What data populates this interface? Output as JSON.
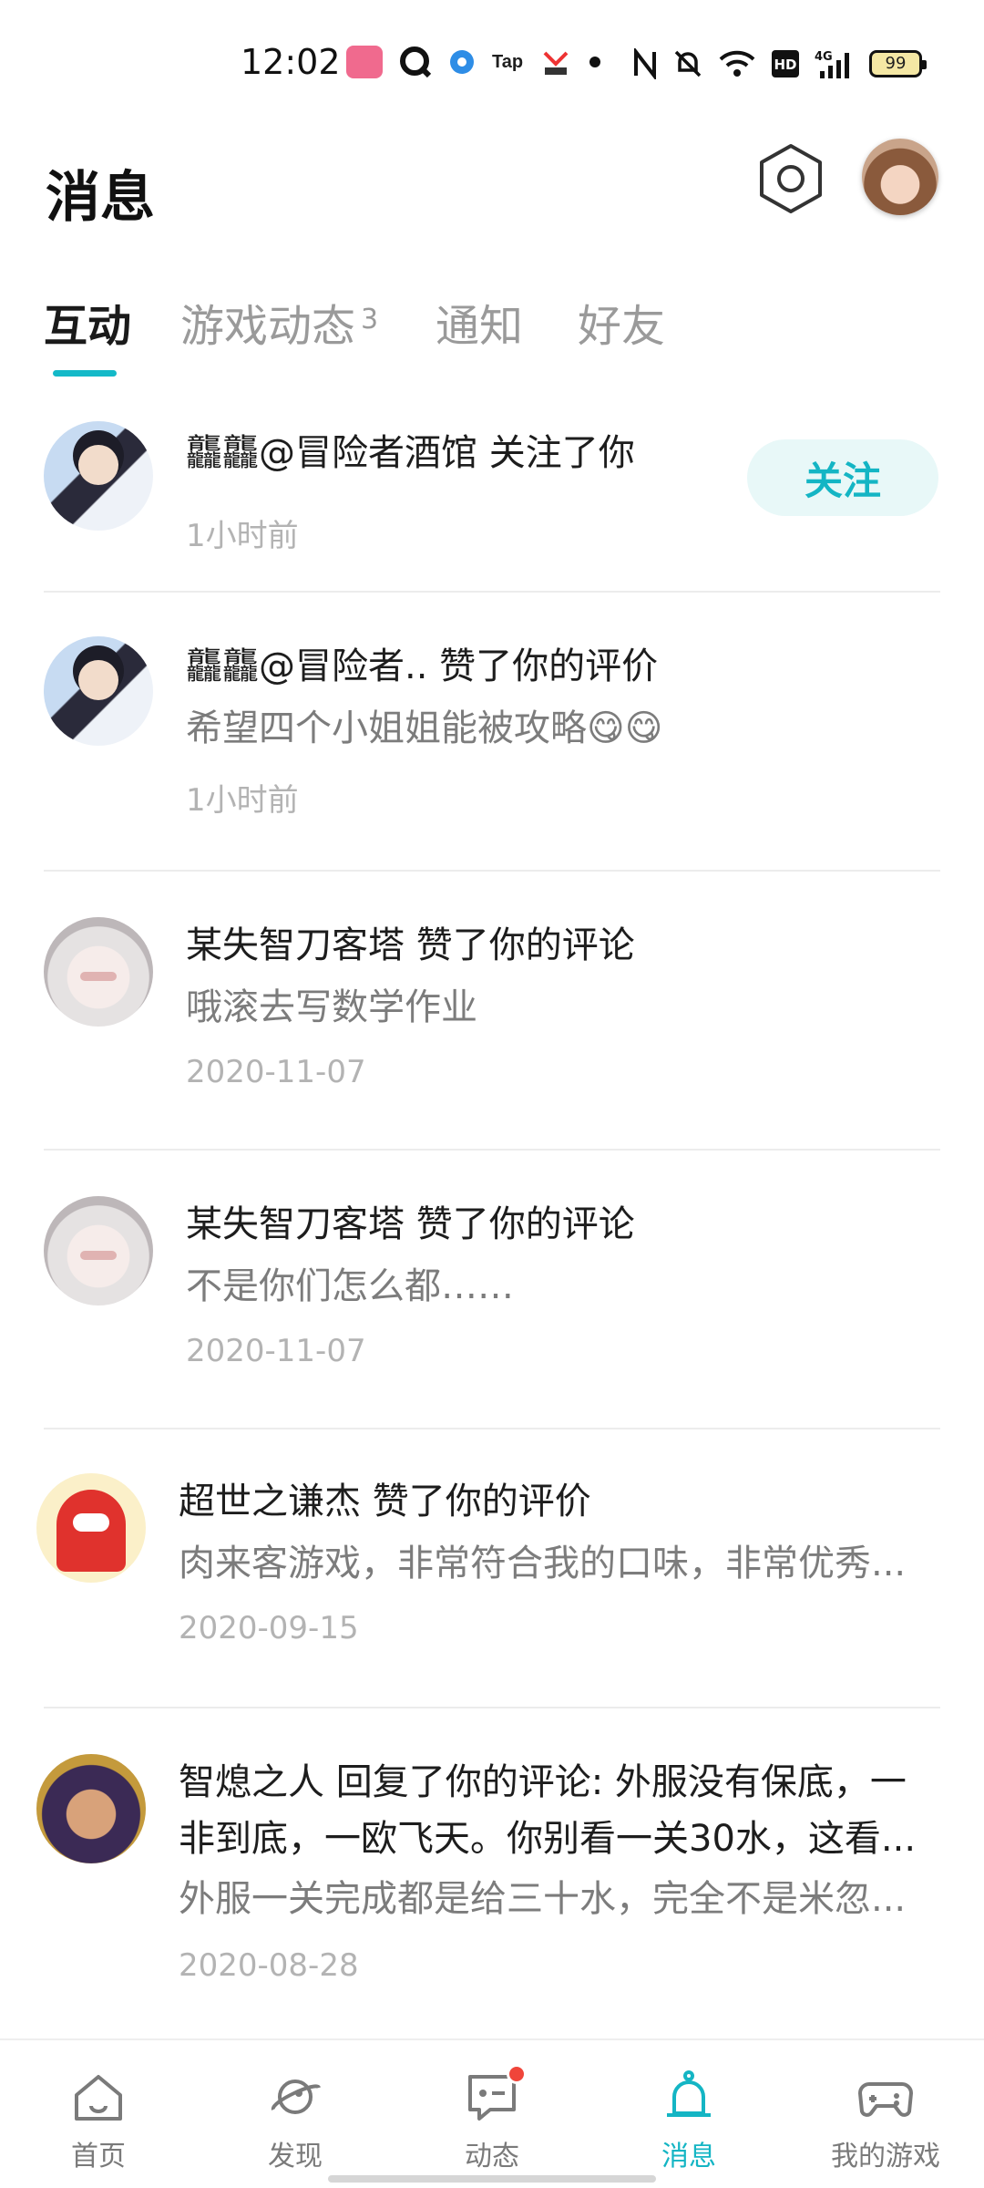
{
  "status_bar": {
    "time": "12:02",
    "battery": "99",
    "icons": [
      "bilibili-icon",
      "q-icon",
      "dot-app-icon",
      "tap-icon",
      "bird-app-icon",
      "dot-icon",
      "nfc-icon",
      "mute-icon",
      "wifi-icon",
      "hd-icon",
      "signal-4g-icon",
      "battery-icon"
    ]
  },
  "header": {
    "title": "消息"
  },
  "tabs": [
    {
      "label": "互动",
      "active": true
    },
    {
      "label": "游戏动态",
      "badge": "3"
    },
    {
      "label": "通知"
    },
    {
      "label": "好友"
    }
  ],
  "messages": [
    {
      "avatar": "maid-girl-avatar",
      "title": "龘龘@冒险者酒馆 关注了你",
      "time": "1小时前",
      "action": "关注"
    },
    {
      "avatar": "maid-girl-avatar",
      "title": "龘龘@冒险者.. 赞了你的评价",
      "content": "希望四个小姐姐能被攻略😋😋",
      "time": "1小时前"
    },
    {
      "avatar": "white-fox-girl-avatar",
      "title": "某失智刀客塔 赞了你的评论",
      "content": "哦滚去写数学作业",
      "time": "2020-11-07"
    },
    {
      "avatar": "white-fox-girl-avatar",
      "title": "某失智刀客塔 赞了你的评论",
      "content": "不是你们怎么都……",
      "time": "2020-11-07"
    },
    {
      "avatar": "red-mascot-avatar",
      "title": "超世之谦杰 赞了你的评价",
      "content": "肉来客游戏，非常符合我的口味，非常优秀...",
      "time": "2020-09-15"
    },
    {
      "avatar": "warrior-avatar",
      "title": "智熄之人 回复了你的评论: 外服没有保底，一",
      "title_line2": "非到底，一欧飞天。你别看一关30水，这看...",
      "content": "外服一关完成都是给三十水，完全不是米忽...",
      "time": "2020-08-28"
    }
  ],
  "bottom_nav": [
    {
      "label": "首页",
      "icon": "home-icon"
    },
    {
      "label": "发现",
      "icon": "planet-icon"
    },
    {
      "label": "动态",
      "icon": "chat-icon",
      "has_dot": true
    },
    {
      "label": "消息",
      "icon": "bell-icon",
      "active": true
    },
    {
      "label": "我的游戏",
      "icon": "gamepad-icon"
    }
  ],
  "colors": {
    "accent": "#14b5c4",
    "badge_red": "#f0453a",
    "text_primary": "#1d1d1d",
    "text_secondary": "#7c7c7c",
    "text_time": "#b3b3b3"
  }
}
